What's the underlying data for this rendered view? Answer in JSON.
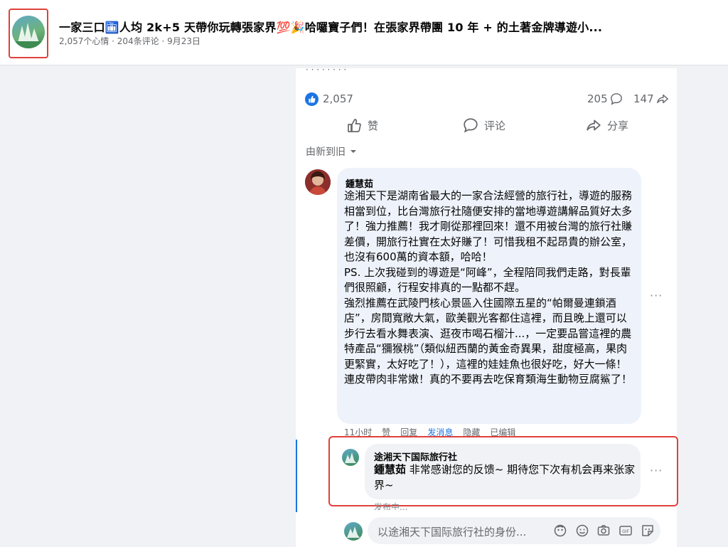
{
  "header": {
    "title": "一家三口🛅人均 2k+5 天帶你玩轉張家界💯🎉哈囉寶子們！在張家界帶團 10 年 + 的土著金牌導遊小...",
    "meta": "2,057个心情 · 204条评论 · 9月23日"
  },
  "stats": {
    "likes": "2,057",
    "comments": "205",
    "shares": "147"
  },
  "actions": {
    "like": "赞",
    "comment": "评论",
    "share": "分享"
  },
  "sort": {
    "label": "由新到旧"
  },
  "comment": {
    "author": "鍾慧茹",
    "paragraphs": [
      "途湘天下是湖南省最大的一家合法經營的旅行社，導遊的服務相當到位，比台灣旅行社隨便安排的當地導遊講解品質好太多了！強力推薦！我才剛從那裡回來！還不用被台灣的旅行社賺差價，開旅行社實在太好賺了！可惜我租不起昂貴的辦公室，也沒有600萬的資本額，哈哈！",
      "PS. 上次我碰到的導遊是“阿峰”，全程陪同我們走路，對長輩們很照顧，行程安排真的一點都不趕。",
      "強烈推薦在武陵門核心景區入住國際五星的“帕爾曼連鎖酒店”，房間寬敞大氣，歐美觀光客都住這裡，而且晚上還可以步行去看水舞表演、逛夜市喝石榴汁...，一定要品嘗這裡的農特產品“獼猴桃”（類似紐西蘭的黃金奇異果，甜度極高，果肉更緊實，太好吃了！），這裡的娃娃魚也很好吃，好大一條！連皮帶肉非常嫩！真的不要再去吃保育類海生動物豆腐鯊了！"
    ],
    "time": "11小时",
    "like": "赞",
    "reply": "回复",
    "send_message": "发消息",
    "hide": "隐藏",
    "edited": "已编辑"
  },
  "reply": {
    "author": "途湘天下国际旅行社",
    "mention": "鍾慧茹",
    "text": "非常感谢您的反馈~ 期待您下次有机会再来张家界~",
    "status": "发布中..."
  },
  "composer": {
    "placeholder": "以途湘天下国际旅行社的身份..."
  },
  "colors": {
    "brand_blue": "#1b74e4",
    "highlight_red": "#e0413a",
    "bubble_bg": "#eef3fb"
  },
  "icons": [
    "like-reaction-icon",
    "comment-icon",
    "share-icon",
    "thumbs-up-icon",
    "sort-dropdown-icon",
    "more-icon",
    "avatar-sticker-icon",
    "emoji-icon",
    "camera-icon",
    "gif-icon",
    "sticker-icon"
  ]
}
